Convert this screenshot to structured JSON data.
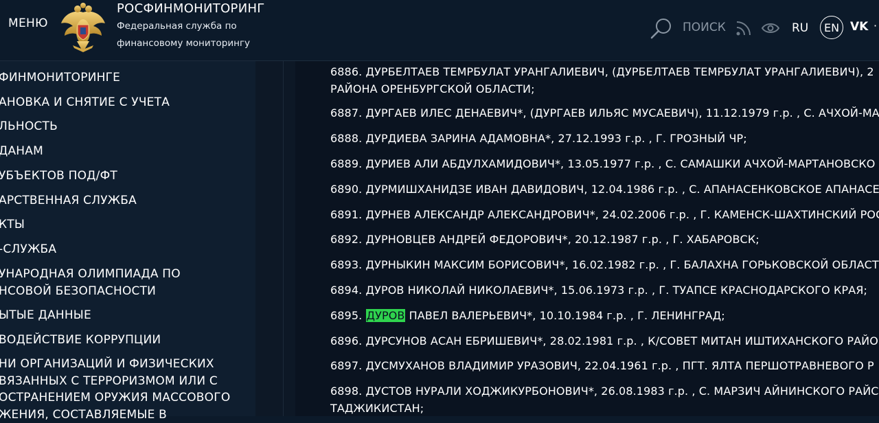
{
  "header": {
    "menu_label": "МЕНЮ",
    "org_name": "РОСФИНМОНИТОРИНГ",
    "org_sub_line1": "Федеральная служба по",
    "org_sub_line2": "финансовому мониторингу",
    "search_label": "ПОИСК",
    "lang_ru": "RU",
    "lang_en": "EN",
    "vk_label": "VK",
    "more_label": "·",
    "icons": [
      "emblem-icon",
      "search-icon",
      "rss-icon",
      "eye-icon",
      "vk-icon"
    ]
  },
  "sidebar": {
    "items": [
      {
        "lines": [
          "ФИНМОНИТОРИНГЕ"
        ]
      },
      {
        "lines": [
          "АНОВКА И СНЯТИЕ С УЧЕТА"
        ]
      },
      {
        "lines": [
          "ЛЬНОСТЬ"
        ]
      },
      {
        "lines": [
          "ДАНАМ"
        ]
      },
      {
        "lines": [
          "УБЪЕКТОВ ПОД/ФТ"
        ]
      },
      {
        "lines": [
          "АРСТВЕННАЯ СЛУЖБА"
        ]
      },
      {
        "lines": [
          "КТЫ"
        ]
      },
      {
        "lines": [
          "-СЛУЖБА"
        ]
      },
      {
        "lines": [
          "УНАРОДНАЯ ОЛИМПИАДА ПО",
          "НСОВОЙ БЕЗОПАСНОСТИ"
        ]
      },
      {
        "lines": [
          "ЫТЫЕ ДАННЫЕ"
        ]
      },
      {
        "lines": [
          "ВОДЕЙСТВИЕ КОРРУПЦИИ"
        ]
      },
      {
        "lines": [
          "НИ ОРГАНИЗАЦИЙ И ФИЗИЧЕСКИХ",
          "ВЯЗАННЫХ С ТЕРРОРИЗМОМ ИЛИ С",
          "ОСТРАНЕНИЕМ ОРУЖИЯ МАССОВОГО",
          "ЖЕНИЯ, СОСТАВЛЯЕМЫЕ В"
        ]
      }
    ]
  },
  "content": {
    "highlight_color": "#2fd34e",
    "entries": [
      {
        "lines": [
          "6886. ДУРБЕЛТАЕВ ТЕМРБУЛАТ УРАНГАЛИЕВИЧ, (ДУРБЕЛТАЕВ ТЕМРБУЛАТ УРАНГАЛИЕВИЧ), 2",
          "РАЙОНА ОРЕНБУРГСКОЙ ОБЛАСТИ;"
        ]
      },
      {
        "lines": [
          "6887. ДУРГАЕВ ИЛЕС ДЕНАЕВИЧ*, (ДУРГАЕВ ИЛЬЯС МУСАЕВИЧ), 11.12.1979 г.р. , С. АЧХОЙ-МАР"
        ]
      },
      {
        "lines": [
          "6888. ДУРДИЕВА ЗАРИНА АДАМОВНА*, 27.12.1993 г.р. , Г. ГРОЗНЫЙ ЧР;"
        ]
      },
      {
        "lines": [
          "6889. ДУРИЕВ АЛИ АБДУЛХАМИДОВИЧ*, 13.05.1977 г.р. , С. САМАШКИ АЧХОЙ-МАРТАНОВСКО"
        ]
      },
      {
        "lines": [
          "6890. ДУРМИШХАНИДЗЕ ИВАН ДАВИДОВИЧ, 12.04.1986 г.р. , С. АПАНАСЕНКОВСКОЕ АПАНАСЕ"
        ]
      },
      {
        "lines": [
          "6891. ДУРНЕВ АЛЕКСАНДР АЛЕКСАНДРОВИЧ*, 24.02.2006 г.р. , Г. КАМЕНСК-ШАХТИНСКИЙ РОС"
        ]
      },
      {
        "lines": [
          "6892. ДУРНОВЦЕВ АНДРЕЙ ФЕДОРОВИЧ*, 20.12.1987 г.р. , Г. ХАБАРОВСК;"
        ]
      },
      {
        "lines": [
          "6893. ДУРНЫКИН МАКСИМ БОРИСОВИЧ*, 16.02.1982 г.р. , Г. БАЛАХНА ГОРЬКОВСКОЙ ОБЛАСТ"
        ]
      },
      {
        "lines": [
          "6894. ДУРОВ НИКОЛАЙ НИКОЛАЕВИЧ*, 15.06.1973 г.р. , Г. ТУАПСЕ КРАСНОДАРСКОГО КРАЯ;"
        ]
      },
      {
        "prefix": "6895. ",
        "highlight": "ДУРОВ",
        "suffix": " ПАВЕЛ ВАЛЕРЬЕВИЧ*, 10.10.1984 г.р. , Г. ЛЕНИНГРАД;"
      },
      {
        "lines": [
          "6896. ДУРСУНОВ АСАН ЕБРИШЕВИЧ*, 28.02.1981 г.р. , К/СОВЕТ МИТАН ИШТИХАНСКОГО РАЙО"
        ]
      },
      {
        "lines": [
          "6897. ДУСМУХАНОВ ВЛАДИМИР УРАЗОВИЧ, 22.04.1961 г.р. , ПГТ. ЯЛТА ПЕРШОТРАВНЕВОГО Р"
        ]
      },
      {
        "lines": [
          "6898. ДУСТОВ НУРАЛИ ХОДЖИКУРБОНОВИЧ*, 26.08.1983 г.р. , С. МАРЗИЧ АЙНИНСКОГО РАЙС",
          "ТАДЖИКИСТАН;"
        ]
      }
    ]
  }
}
